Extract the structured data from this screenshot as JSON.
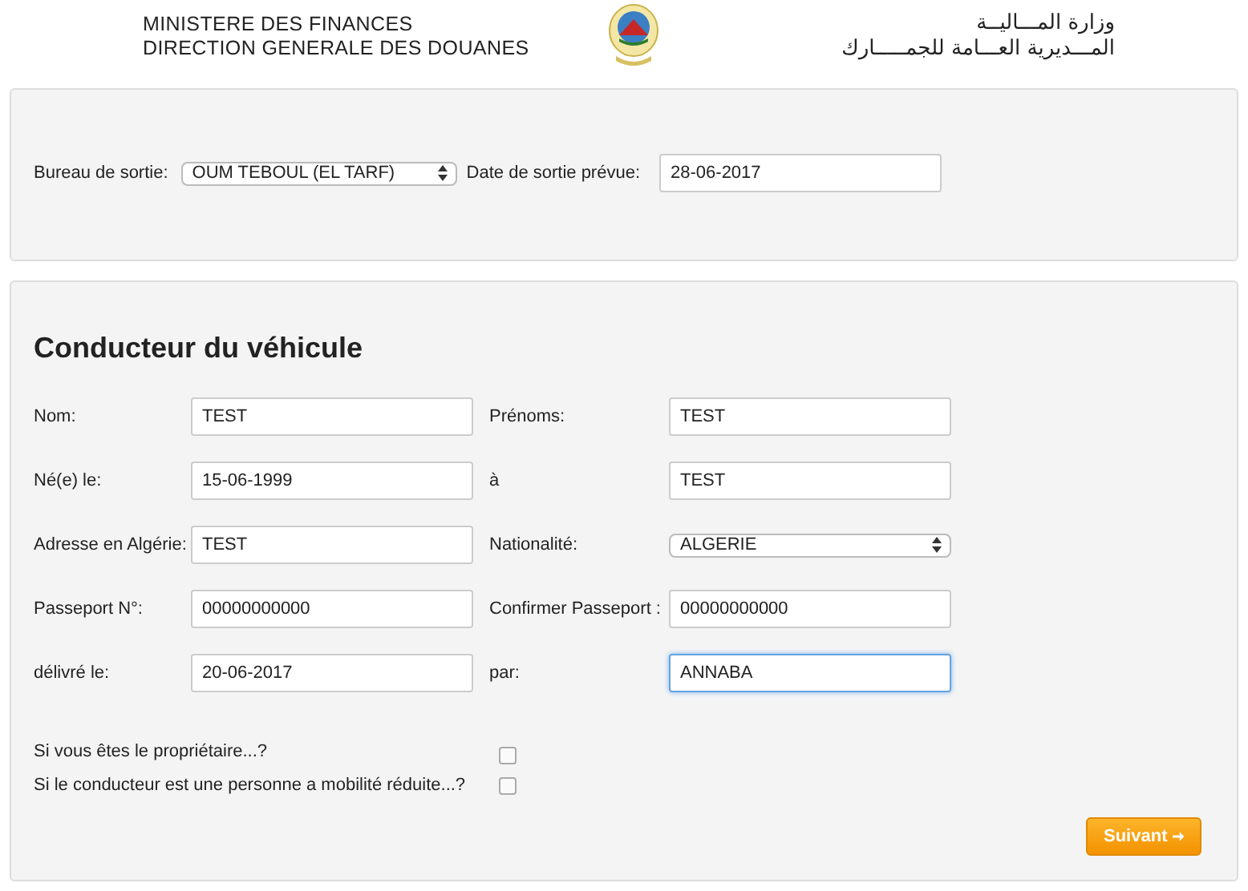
{
  "header": {
    "ministry_fr": "MINISTERE DES FINANCES",
    "direction_fr": "DIRECTION GENERALE DES DOUANES",
    "ministry_ar": "وزارة المـــاليــة",
    "direction_ar": "المـــديرية العـــامة للجمـــــارك"
  },
  "exit": {
    "fields": [
      {
        "label": "Bureau de sortie:",
        "kind": "select",
        "value": "OUM TEBOUL (EL TARF)",
        "focused": false
      },
      {
        "label": "Date de sortie prévue:",
        "kind": "text",
        "value": "28-06-2017",
        "focused": false
      }
    ]
  },
  "driver": {
    "title": "Conducteur du véhicule",
    "fields": [
      {
        "label": "Nom:",
        "kind": "text",
        "value": "TEST",
        "focused": false
      },
      {
        "label": "Prénoms:",
        "kind": "text",
        "value": "TEST",
        "focused": false
      },
      {
        "label": "Né(e) le:",
        "kind": "text",
        "value": "15-06-1999",
        "focused": false
      },
      {
        "label": "à",
        "kind": "text",
        "value": "TEST",
        "focused": false
      },
      {
        "label": "Adresse en Algérie:",
        "kind": "text",
        "value": "TEST",
        "focused": false
      },
      {
        "label": "Nationalité:",
        "kind": "select",
        "value": "ALGERIE",
        "focused": false
      },
      {
        "label": "Passeport N°:",
        "kind": "text",
        "value": "00000000000",
        "focused": false
      },
      {
        "label": "Confirmer Passeport :",
        "kind": "text",
        "value": "00000000000",
        "focused": false
      },
      {
        "label": "délivré le:",
        "kind": "text",
        "value": "20-06-2017",
        "focused": false
      },
      {
        "label": "par:",
        "kind": "text",
        "value": "ANNABA",
        "focused": true
      }
    ],
    "checks": [
      {
        "label": "Si vous êtes le propriétaire...?",
        "checked": false
      },
      {
        "label": "Si le conducteur est une personne a mobilité réduite...?",
        "checked": false
      }
    ],
    "next_button": "Suivant"
  }
}
